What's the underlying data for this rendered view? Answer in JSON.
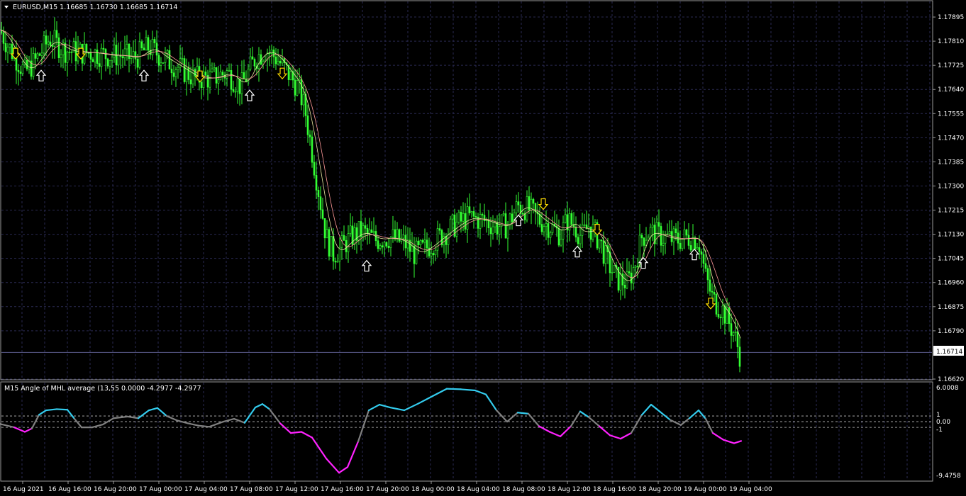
{
  "chart_data": [
    {
      "type": "candlestick",
      "title": "EURUSD,M15  1.16685 1.16730 1.16685 1.16714",
      "symbol": "EURUSD",
      "timeframe": "M15",
      "ohlc_last": [
        1.16685,
        1.1673,
        1.16685,
        1.16714
      ],
      "current_price": 1.16714,
      "current_price_label": "1.16714",
      "ylim": [
        1.1662,
        1.1795
      ],
      "yticks": [
        "1.17895",
        "1.17810",
        "1.17725",
        "1.17640",
        "1.17555",
        "1.17470",
        "1.17385",
        "1.17300",
        "1.17215",
        "1.17130",
        "1.17045",
        "1.16960",
        "1.16875",
        "1.16790",
        "1.16620"
      ],
      "xticks": [
        "16 Aug 2021",
        "16 Aug 16:00",
        "16 Aug 20:00",
        "17 Aug 00:00",
        "17 Aug 04:00",
        "17 Aug 08:00",
        "17 Aug 12:00",
        "17 Aug 16:00",
        "17 Aug 20:00",
        "18 Aug 00:00",
        "18 Aug 04:00",
        "18 Aug 08:00",
        "18 Aug 12:00",
        "18 Aug 16:00",
        "18 Aug 20:00",
        "19 Aug 00:00",
        "19 Aug 04:00"
      ],
      "price_path": [
        [
          0,
          1.1785
        ],
        [
          8,
          1.1781
        ],
        [
          20,
          1.1776
        ],
        [
          35,
          1.177
        ],
        [
          50,
          1.1774
        ],
        [
          70,
          1.1782
        ],
        [
          90,
          1.1778
        ],
        [
          110,
          1.1777
        ],
        [
          130,
          1.1777
        ],
        [
          150,
          1.1776
        ],
        [
          170,
          1.1776
        ],
        [
          190,
          1.1775
        ],
        [
          210,
          1.1779
        ],
        [
          230,
          1.1775
        ],
        [
          250,
          1.1772
        ],
        [
          275,
          1.1768
        ],
        [
          300,
          1.1768
        ],
        [
          320,
          1.177
        ],
        [
          340,
          1.1765
        ],
        [
          360,
          1.1775
        ],
        [
          375,
          1.1778
        ],
        [
          390,
          1.1775
        ],
        [
          405,
          1.177
        ],
        [
          420,
          1.1765
        ],
        [
          430,
          1.1757
        ],
        [
          440,
          1.1742
        ],
        [
          450,
          1.1727
        ],
        [
          460,
          1.1712
        ],
        [
          470,
          1.1706
        ],
        [
          480,
          1.1708
        ],
        [
          495,
          1.1712
        ],
        [
          510,
          1.1714
        ],
        [
          530,
          1.1711
        ],
        [
          550,
          1.1712
        ],
        [
          570,
          1.171
        ],
        [
          585,
          1.1706
        ],
        [
          600,
          1.1708
        ],
        [
          620,
          1.1712
        ],
        [
          640,
          1.1716
        ],
        [
          660,
          1.1719
        ],
        [
          680,
          1.1718
        ],
        [
          700,
          1.1716
        ],
        [
          715,
          1.1716
        ],
        [
          730,
          1.1723
        ],
        [
          745,
          1.1722
        ],
        [
          760,
          1.1718
        ],
        [
          775,
          1.1716
        ],
        [
          790,
          1.1713
        ],
        [
          800,
          1.1718
        ],
        [
          810,
          1.1716
        ],
        [
          820,
          1.1712
        ],
        [
          830,
          1.1716
        ],
        [
          845,
          1.1711
        ],
        [
          855,
          1.1704
        ],
        [
          870,
          1.1697
        ],
        [
          885,
          1.1696
        ],
        [
          895,
          1.1702
        ],
        [
          905,
          1.1712
        ],
        [
          915,
          1.1714
        ],
        [
          935,
          1.1712
        ],
        [
          955,
          1.1711
        ],
        [
          970,
          1.1712
        ],
        [
          985,
          1.1711
        ],
        [
          995,
          1.1698
        ],
        [
          1005,
          1.169
        ],
        [
          1020,
          1.1686
        ],
        [
          1035,
          1.1678
        ],
        [
          1045,
          1.1669
        ]
      ],
      "buy_arrows": [
        [
          58,
          1.1771
        ],
        [
          203,
          1.1771
        ],
        [
          352,
          1.1764
        ],
        [
          517,
          1.1704
        ],
        [
          731,
          1.172
        ],
        [
          814,
          1.1709
        ],
        [
          907,
          1.1705
        ],
        [
          979,
          1.1708
        ]
      ],
      "sell_arrows": [
        [
          22,
          1.1775
        ],
        [
          114,
          1.1775
        ],
        [
          282,
          1.1767
        ],
        [
          398,
          1.1768
        ],
        [
          766,
          1.1722
        ],
        [
          842,
          1.1713
        ],
        [
          1002,
          1.1687
        ]
      ]
    },
    {
      "type": "line",
      "title": "M15 Angle of MHL average (13,55 0.0000 -4.2977 -4.2977",
      "ylim": [
        -9.4758,
        6.0008
      ],
      "yticks": [
        "6.0008",
        "1",
        "0.00",
        "-1",
        "-9.4758"
      ],
      "levels": [
        1,
        0,
        -1
      ],
      "colors": {
        "up": "#33ccee",
        "down": "#ff22ff",
        "flat": "#808080"
      },
      "points": [
        [
          0,
          -0.4
        ],
        [
          20,
          -1.0
        ],
        [
          35,
          -1.8
        ],
        [
          45,
          -1.2
        ],
        [
          55,
          1.2
        ],
        [
          65,
          2.0
        ],
        [
          80,
          2.2
        ],
        [
          95,
          2.1
        ],
        [
          105,
          0.5
        ],
        [
          115,
          -1.0
        ],
        [
          130,
          -1.0
        ],
        [
          145,
          -0.5
        ],
        [
          160,
          0.6
        ],
        [
          180,
          0.9
        ],
        [
          195,
          0.6
        ],
        [
          210,
          2.0
        ],
        [
          222,
          2.4
        ],
        [
          235,
          1.0
        ],
        [
          250,
          0.2
        ],
        [
          265,
          -0.3
        ],
        [
          280,
          -0.7
        ],
        [
          295,
          -0.9
        ],
        [
          315,
          0.0
        ],
        [
          330,
          0.5
        ],
        [
          345,
          -0.2
        ],
        [
          360,
          2.5
        ],
        [
          370,
          3.1
        ],
        [
          380,
          2.2
        ],
        [
          395,
          -0.3
        ],
        [
          410,
          -2.0
        ],
        [
          425,
          -1.8
        ],
        [
          440,
          -2.8
        ],
        [
          460,
          -6.5
        ],
        [
          478,
          -9.0
        ],
        [
          490,
          -8.0
        ],
        [
          505,
          -3.5
        ],
        [
          520,
          2.0
        ],
        [
          535,
          3.0
        ],
        [
          550,
          2.5
        ],
        [
          570,
          2.0
        ],
        [
          590,
          3.2
        ],
        [
          610,
          4.5
        ],
        [
          630,
          5.8
        ],
        [
          650,
          5.7
        ],
        [
          670,
          5.5
        ],
        [
          685,
          4.8
        ],
        [
          700,
          2.0
        ],
        [
          715,
          0.0
        ],
        [
          730,
          1.6
        ],
        [
          745,
          1.4
        ],
        [
          760,
          -0.8
        ],
        [
          775,
          -1.8
        ],
        [
          790,
          -2.6
        ],
        [
          805,
          -0.8
        ],
        [
          818,
          1.8
        ],
        [
          830,
          0.8
        ],
        [
          845,
          -0.8
        ],
        [
          860,
          -2.4
        ],
        [
          875,
          -3.0
        ],
        [
          890,
          -2.0
        ],
        [
          905,
          1.2
        ],
        [
          918,
          3.0
        ],
        [
          930,
          1.8
        ],
        [
          945,
          0.3
        ],
        [
          960,
          -0.6
        ],
        [
          972,
          0.6
        ],
        [
          985,
          2.0
        ],
        [
          995,
          0.5
        ],
        [
          1005,
          -2.0
        ],
        [
          1020,
          -3.2
        ],
        [
          1035,
          -3.8
        ],
        [
          1045,
          -3.4
        ]
      ]
    }
  ]
}
